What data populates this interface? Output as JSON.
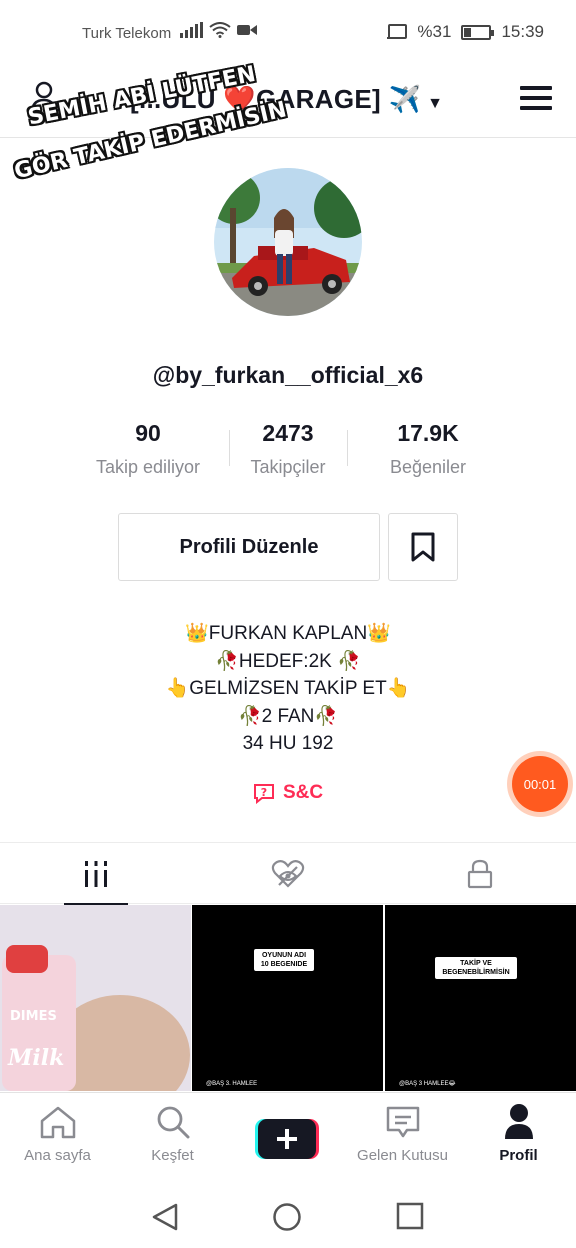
{
  "status_bar": {
    "carrier": "Turk Telekom",
    "battery": "%31",
    "battery_level": 0.31,
    "time": "15:39"
  },
  "header": {
    "title": "[...ULU ❤️GARAGE] ✈️",
    "overlay_line_1": "SEMİH ABİ LÜTFEN",
    "overlay_line_2": "GÖR TAKİP EDERMİSİN"
  },
  "profile": {
    "handle": "@by_furkan__official_x6",
    "stats": [
      {
        "value": "90",
        "label": "Takip ediliyor"
      },
      {
        "value": "2473",
        "label": "Takipçiler"
      },
      {
        "value": "17.9K",
        "label": "Beğeniler"
      }
    ],
    "edit_label": "Profili Düzenle",
    "bio": [
      "👑FURKAN KAPLAN👑",
      "🥀HEDEF:2K 🥀",
      "👆GELMİZSEN TAKİP ET👆",
      "🥀2 FAN🥀",
      "34 HU 192"
    ],
    "link_label": "S&C",
    "timer": "00:01"
  },
  "videos": [
    {
      "caption": "",
      "footer": ""
    },
    {
      "caption": "OYUNUN ADI 10 BEGENIDE",
      "footer": "@BAŞ 3. HAMLEE"
    },
    {
      "caption": "TAKİP VE BEGENEBİLİRMİSİN",
      "footer": "@BAŞ 3 HAMLEE😂"
    }
  ],
  "nav": {
    "items": [
      {
        "label": "Ana sayfa",
        "icon": "home-icon"
      },
      {
        "label": "Keşfet",
        "icon": "search-icon"
      },
      {
        "label": "",
        "icon": "plus-icon"
      },
      {
        "label": "Gelen Kutusu",
        "icon": "inbox-icon"
      },
      {
        "label": "Profil",
        "icon": "profile-icon"
      }
    ]
  },
  "colors": {
    "accent": "#fe2c55",
    "timer": "#ff5a1f",
    "text": "#161823",
    "muted": "#8a8b91"
  }
}
